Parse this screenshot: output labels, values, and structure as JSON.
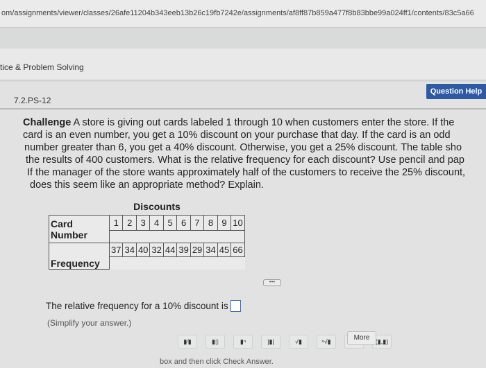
{
  "browser": {
    "url": "om/assignments/viewer/classes/26afe11204b343eeb13b26c19fb7242e/assignments/af8ff87b859a477f8b83bbe99a024ff1/contents/83c5a66"
  },
  "breadcrumb": "tice & Problem Solving",
  "question": {
    "id": "7.2.PS-12",
    "help_label": "Question Help",
    "prompt_label": "Challenge",
    "lines": [
      "A store is giving out cards labeled 1 through 10 when customers enter the store. If the",
      "card is an even number, you get a 10% discount on your purchase that day. If the card is an odd",
      "number greater than 6, you get a 40% discount. Otherwise, you get a 25% discount. The table sho",
      "the results of 400 customers. What is the relative frequency for each discount? Use pencil and pap",
      "If the manager of the store wants approximately half of the customers to receive the 25% discount,",
      "does this seem like an appropriate method? Explain."
    ]
  },
  "table": {
    "caption": "Discounts",
    "row1_header": "Card Number",
    "row2_header": "Frequency",
    "cards": [
      "1",
      "2",
      "3",
      "4",
      "5",
      "6",
      "7",
      "8",
      "9",
      "10"
    ],
    "frequencies": [
      "37",
      "34",
      "40",
      "32",
      "44",
      "39",
      "29",
      "34",
      "45",
      "66"
    ]
  },
  "expand_label": "•••",
  "answer": {
    "text": "The relative frequency for a 10% discount is",
    "hint": "(Simplify your answer.)"
  },
  "toolbar": {
    "buttons": [
      "▮⁄▮",
      "▮▯",
      "▮ⁿ",
      "|▮|",
      "√▮",
      "ⁿ√▮",
      "▮.",
      "(▮,▮)"
    ],
    "more_label": "More"
  },
  "footer": "box and then click Check Answer."
}
